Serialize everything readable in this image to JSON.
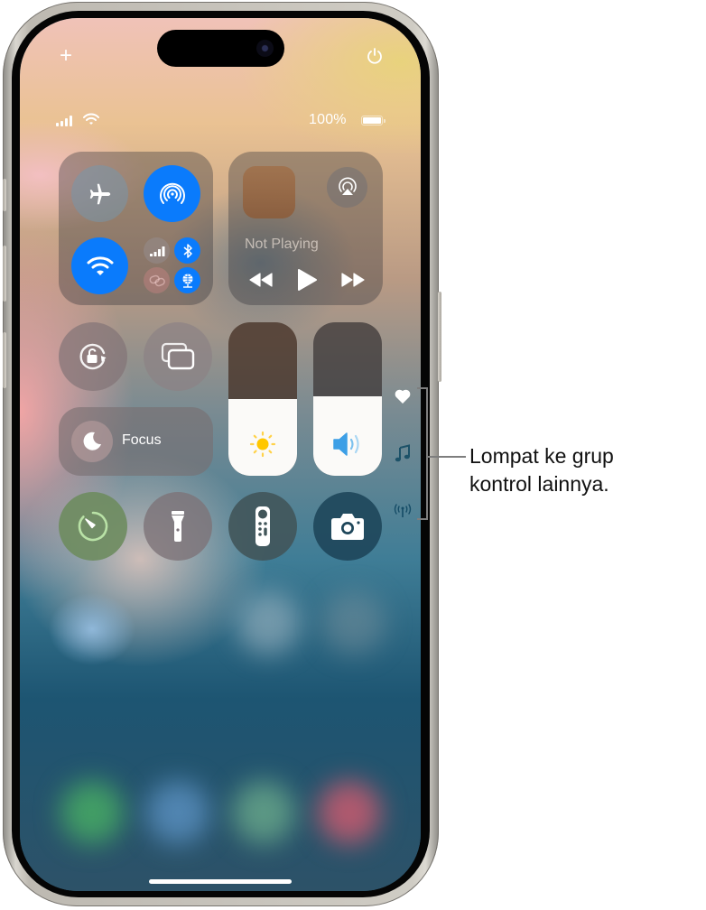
{
  "device": "iPhone",
  "top_bar": {
    "add_icon": "plus-icon",
    "power_icon": "power-icon"
  },
  "status_bar": {
    "signal_bars": 4,
    "wifi": true,
    "battery_percent": "100%",
    "battery_level": 1.0
  },
  "connectivity": {
    "airplane_mode": {
      "icon": "airplane-icon",
      "active": false
    },
    "airdrop": {
      "icon": "airdrop-icon",
      "active": true
    },
    "wifi": {
      "icon": "wifi-icon",
      "active": true
    },
    "cellular": {
      "icon": "cellular-icon",
      "active": false
    },
    "bluetooth": {
      "icon": "bluetooth-icon",
      "active": true
    },
    "personal_hotspot": {
      "icon": "hotspot-link-icon",
      "active": false
    },
    "vpn": {
      "icon": "network-globe-icon",
      "active": true
    }
  },
  "media": {
    "status": "Not Playing",
    "airplay_icon": "airplay-icon",
    "controls": [
      "rewind-icon",
      "play-icon",
      "fast-forward-icon"
    ]
  },
  "controls": {
    "orientation_lock": {
      "icon": "rotation-lock-icon"
    },
    "screen_mirroring": {
      "icon": "screen-mirroring-icon"
    },
    "focus": {
      "label": "Focus",
      "icon": "moon-icon"
    },
    "brightness": {
      "icon": "sun-icon",
      "level": 0.5
    },
    "volume": {
      "icon": "speaker-icon",
      "level": 0.52
    },
    "timer": {
      "icon": "timer-icon"
    },
    "flashlight": {
      "icon": "flashlight-icon"
    },
    "remote": {
      "icon": "apple-tv-remote-icon"
    },
    "camera": {
      "icon": "camera-icon"
    }
  },
  "group_nav": [
    "heart-icon",
    "music-note-icon",
    "antenna-icon"
  ],
  "colors": {
    "active_blue": "#0a7bfc",
    "sun_yellow": "#ffc700",
    "speaker_blue": "#3d9fe6"
  },
  "annotation": {
    "line1": "Lompat ke grup",
    "line2": "kontrol lainnya."
  }
}
